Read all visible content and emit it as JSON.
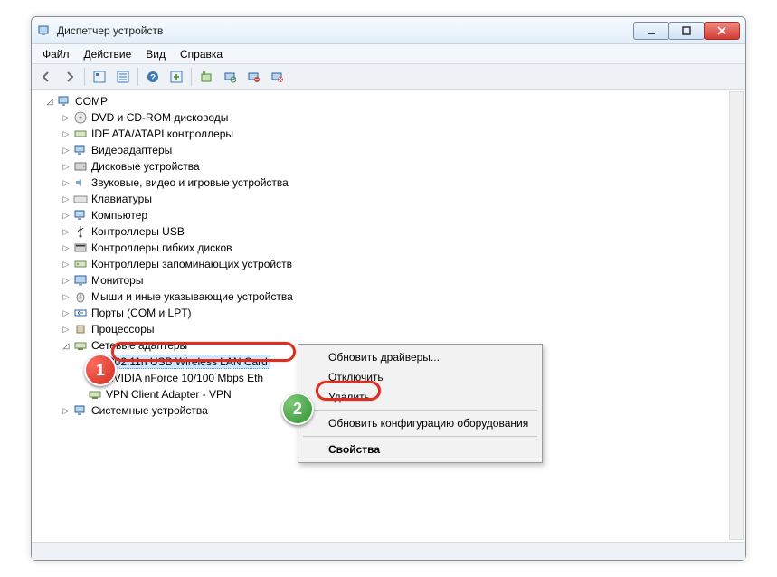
{
  "window": {
    "title": "Диспетчер устройств"
  },
  "menubar": {
    "file": "Файл",
    "action": "Действие",
    "view": "Вид",
    "help": "Справка"
  },
  "tree": {
    "root": "COMP",
    "categories": [
      "DVD и CD-ROM дисководы",
      "IDE ATA/ATAPI контроллеры",
      "Видеоадаптеры",
      "Дисковые устройства",
      "Звуковые, видео и игровые устройства",
      "Клавиатуры",
      "Компьютер",
      "Контроллеры USB",
      "Контроллеры гибких дисков",
      "Контроллеры запоминающих устройств",
      "Мониторы",
      "Мыши и иные указывающие устройства",
      "Порты (COM и LPT)",
      "Процессоры",
      "Сетевые адаптеры"
    ],
    "network_children": [
      "802.11n USB Wireless LAN Card",
      "NVIDIA nForce 10/100 Mbps Eth",
      "VPN Client Adapter - VPN"
    ],
    "last_category": "Системные устройства"
  },
  "context_menu": {
    "update_drivers": "Обновить драйверы...",
    "disable": "Отключить",
    "delete": "Удалить",
    "scan_hw": "Обновить конфигурацию оборудования",
    "properties": "Свойства"
  },
  "badges": {
    "one": "1",
    "two": "2"
  }
}
